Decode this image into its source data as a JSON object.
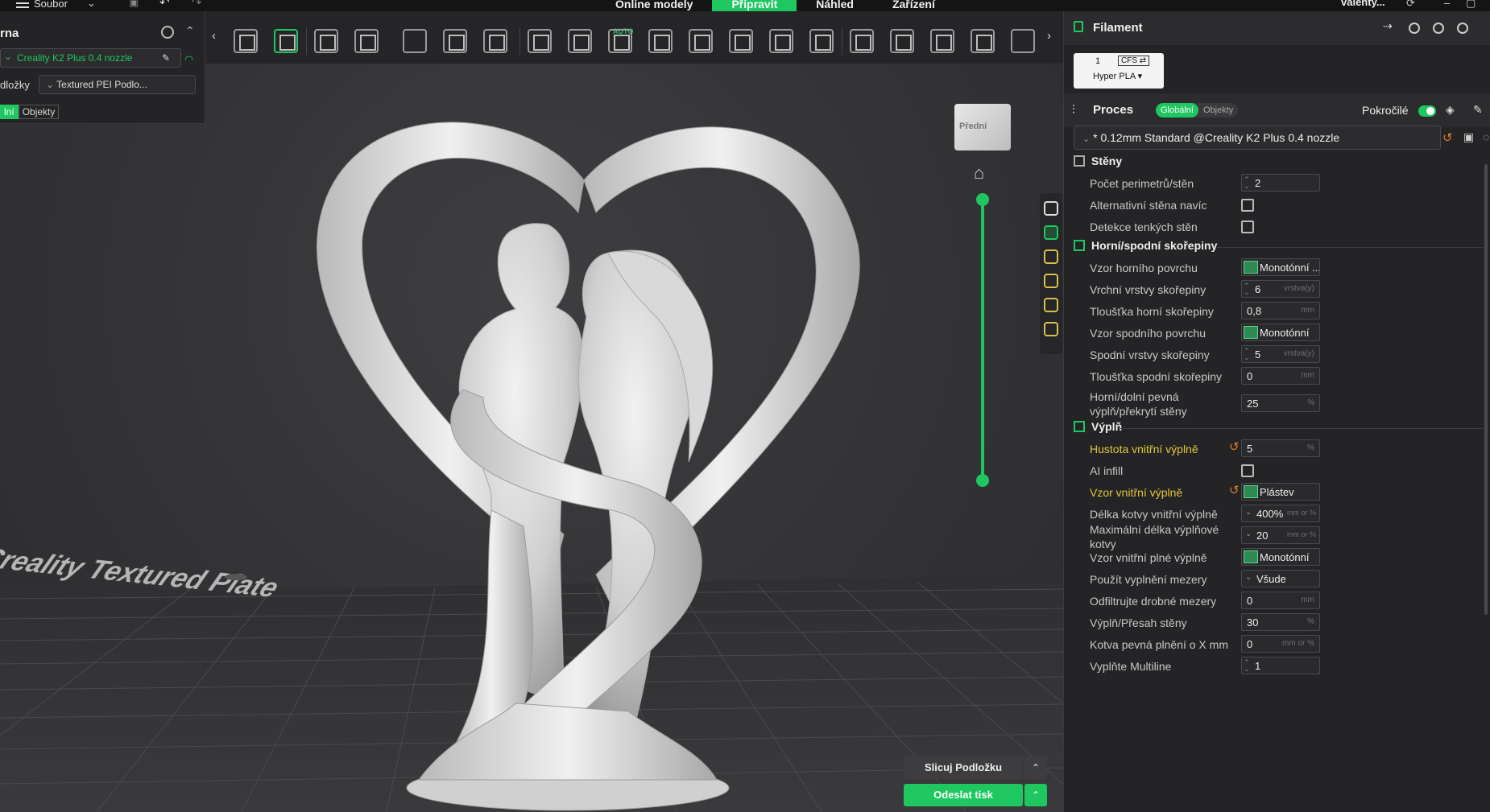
{
  "topbar": {
    "menu_label": "Soubor",
    "tabs": [
      "Online modely",
      "Připravit",
      "Náhled",
      "Zařízení"
    ],
    "active_tab": "Připravit",
    "user": "valenty..."
  },
  "printer_panel": {
    "title": "rna",
    "printer_name": "Creality K2 Plus 0.4 nozzle",
    "plate_label": "dložky",
    "plate_value": "Textured PEI Podlo...",
    "toggle_global": "lní",
    "toggle_objects": "Objekty"
  },
  "toolbar": {
    "auto_label": "AUTO"
  },
  "viewport": {
    "view_cube_label": "Přední",
    "bed_text": "Creality Textured Plate",
    "slice_button": "Slicuj Podložku",
    "send_button": "Odeslat tisk"
  },
  "right_panel": {
    "filament_title": "Filament",
    "filament_slot": "1",
    "filament_cfs": "CFS ⇄",
    "filament_name": "Hyper PLA ▾",
    "process_title": "Proces",
    "process_toggle_global": "Globální",
    "process_toggle_objects": "Objekty",
    "advanced_label": "Pokročilé",
    "profile": "* 0.12mm Standard @Creality K2 Plus 0.4 nozzle"
  },
  "sections": {
    "walls": "Stěny",
    "shells": "Horní/spodní skořepiny",
    "infill": "Výplň"
  },
  "settings": {
    "perimeters": {
      "label": "Počet perimetrů/stěn",
      "value": "2"
    },
    "alt_wall": {
      "label": "Alternativní stěna navíc"
    },
    "thin_walls": {
      "label": "Detekce tenkých stěn"
    },
    "top_pattern": {
      "label": "Vzor horního povrchu",
      "value": "Monotónní ..."
    },
    "top_layers": {
      "label": "Vrchní vrstvy skořepiny",
      "value": "6",
      "unit": "vrstva(y)"
    },
    "top_thickness": {
      "label": "Tloušťka horní skořepiny",
      "value": "0,8",
      "unit": "mm"
    },
    "bottom_pattern": {
      "label": "Vzor spodního povrchu",
      "value": "Monotónní"
    },
    "bottom_layers": {
      "label": "Spodní vrstvy skořepiny",
      "value": "5",
      "unit": "vrstva(y)"
    },
    "bottom_thickness": {
      "label": "Tloušťka spodní skořepiny",
      "value": "0",
      "unit": "mm"
    },
    "solid_overlap": {
      "label": "Horní/dolní pevná výplň/překrytí stěny",
      "value": "25",
      "unit": "%"
    },
    "infill_density": {
      "label": "Hustota vnitřní výplně",
      "value": "5",
      "unit": "%"
    },
    "ai_infill": {
      "label": "AI infill"
    },
    "infill_pattern": {
      "label": "Vzor vnitřní výplně",
      "value": "Plástev"
    },
    "anchor_length": {
      "label": "Délka kotvy vnitřní výplně",
      "value": "400%",
      "unit": "mm or %"
    },
    "anchor_max": {
      "label": "Maximální délka výplňové kotvy",
      "value": "20",
      "unit": "mm or %"
    },
    "solid_infill_pattern": {
      "label": "Vzor vnitřní plné výplně",
      "value": "Monotónní"
    },
    "gap_fill": {
      "label": "Použít vyplnění mezery",
      "value": "Všude"
    },
    "filter_gaps": {
      "label": "Odfiltrujte drobné mezery",
      "value": "0",
      "unit": "mm"
    },
    "infill_wall_overlap": {
      "label": "Výplň/Přesah stěny",
      "value": "30",
      "unit": "%"
    },
    "solid_anchor": {
      "label": "Kotva pevná plnění o X mm",
      "value": "0",
      "unit": "mm or %"
    },
    "multiline": {
      "label": "Vyplňte Multiline",
      "value": "1"
    }
  }
}
